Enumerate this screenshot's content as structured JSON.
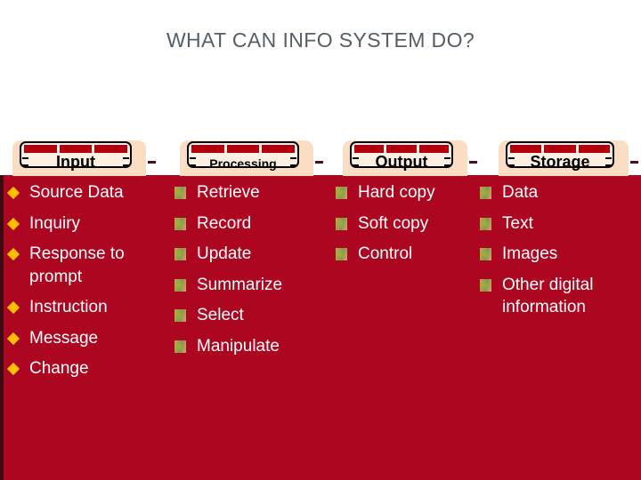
{
  "slide": {
    "title": "WHAT CAN INFO SYSTEM DO?",
    "background_color": "#ac0620",
    "title_color": "#555e66",
    "text_color": "#ffffff",
    "tab_fill_color": "#fdf0e2",
    "tab_strip_color": "#b3000f",
    "diamond_bullet_color": "#ffbf00"
  },
  "tabs": [
    {
      "label": "Input",
      "name": "tab-input"
    },
    {
      "label": "Processing",
      "name": "tab-processing"
    },
    {
      "label": "Output",
      "name": "tab-output"
    },
    {
      "label": "Storage",
      "name": "tab-storage"
    }
  ],
  "columns": {
    "input": {
      "heading": "Input",
      "bullet_style": "diamond",
      "items": [
        "Source Data",
        "Inquiry",
        "Response to\nprompt",
        "Instruction",
        "Message",
        "Change"
      ]
    },
    "processing": {
      "heading": "Processing",
      "bullet_style": "square",
      "items": [
        "Retrieve",
        "Record",
        "Update",
        "Summarize",
        "Select",
        "Manipulate"
      ]
    },
    "output": {
      "heading": "Output",
      "bullet_style": "square",
      "items": [
        "Hard copy",
        "Soft copy",
        "Control"
      ]
    },
    "storage": {
      "heading": "Storage",
      "bullet_style": "square",
      "items": [
        "Data",
        "Text",
        "Images",
        "Other digital\ninformation"
      ]
    }
  }
}
